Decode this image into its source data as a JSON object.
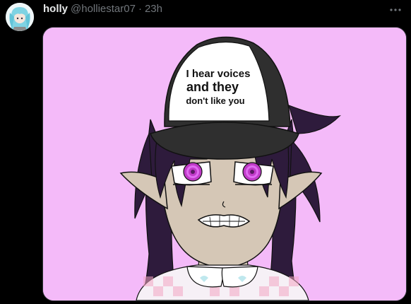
{
  "post": {
    "author": {
      "display_name": "holly",
      "handle": "@holliestar07",
      "separator": "·",
      "timestamp": "23h",
      "avatar_icon": "profile-avatar-icon"
    },
    "more_icon": "more-horizontal-icon",
    "media": {
      "image_icon": "drawing-image",
      "hat_text": [
        "I hear voices",
        "and they",
        "don't like you"
      ],
      "colors": {
        "background": "#f4baf9",
        "hair": "#2e1b3c",
        "skin": "#d5c7b6",
        "eyes": "#c03ac8",
        "cap": "#2f2f2f",
        "cap_front": "#ffffff"
      }
    }
  },
  "theme": {
    "background": "#000000",
    "text_primary": "#e7e9ea",
    "text_secondary": "#71767b",
    "border": "#2f3336"
  }
}
